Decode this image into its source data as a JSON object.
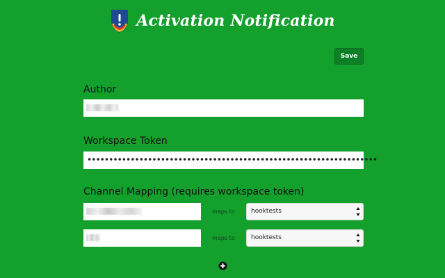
{
  "app": {
    "title": "Activation Notification",
    "logo_icon": "shield-icon",
    "background_color": "#14a02d",
    "save_button_color": "#0d7f26"
  },
  "toolbar": {
    "save_label": "Save"
  },
  "fields": {
    "author": {
      "label": "Author",
      "value": "",
      "value_state": "redacted"
    },
    "workspace_token": {
      "label": "Workspace Token",
      "value": "•••••••••••••••••••••••••••••••••••••••••••••••••••••••••••••••••••"
    }
  },
  "channel_mapping": {
    "label": "Channel Mapping (requires workspace token)",
    "rows": [
      {
        "source_value": "",
        "source_state": "redacted",
        "maps_to_label": "maps to",
        "target_value": "hooktests",
        "target_icon": "select-arrows-icon"
      },
      {
        "source_value": "",
        "source_state": "redacted",
        "maps_to_label": "maps to",
        "target_value": "hooktests",
        "target_icon": "select-arrows-icon"
      }
    ],
    "add_icon": "plus-circle-icon"
  }
}
